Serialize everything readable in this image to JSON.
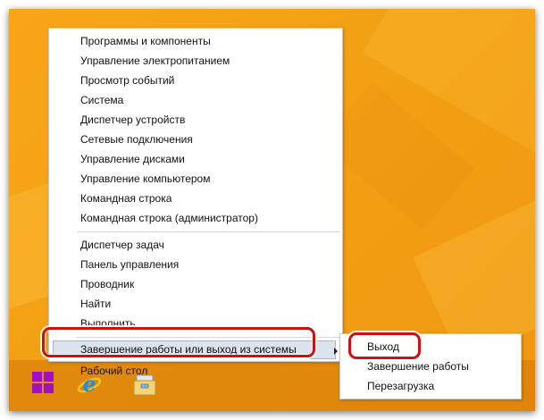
{
  "colors": {
    "desktop": "#f3a114",
    "menu_highlight": "#dbe3ef",
    "callout": "#d01010",
    "start_logo": "#a010c0"
  },
  "context_menu": {
    "items": [
      {
        "label": "Программы и компоненты"
      },
      {
        "label": "Управление электропитанием"
      },
      {
        "label": "Просмотр событий"
      },
      {
        "label": "Система"
      },
      {
        "label": "Диспетчер устройств"
      },
      {
        "label": "Сетевые подключения"
      },
      {
        "label": "Управление дисками"
      },
      {
        "label": "Управление компьютером"
      },
      {
        "label": "Командная строка"
      },
      {
        "label": "Командная строка (администратор)"
      },
      {
        "label": "Диспетчер задач"
      },
      {
        "label": "Панель управления"
      },
      {
        "label": "Проводник"
      },
      {
        "label": "Найти"
      },
      {
        "label": "Выполнить"
      },
      {
        "label": "Завершение работы или выход из системы",
        "has_submenu": true,
        "highlighted": true
      },
      {
        "label": "Рабочий стол"
      }
    ]
  },
  "submenu": {
    "items": [
      {
        "label": "Выход",
        "highlighted": true
      },
      {
        "label": "Завершение работы"
      },
      {
        "label": "Перезагрузка"
      }
    ]
  },
  "taskbar": {
    "icons": [
      "windows-start-icon",
      "internet-explorer-icon",
      "file-explorer-icon"
    ]
  }
}
